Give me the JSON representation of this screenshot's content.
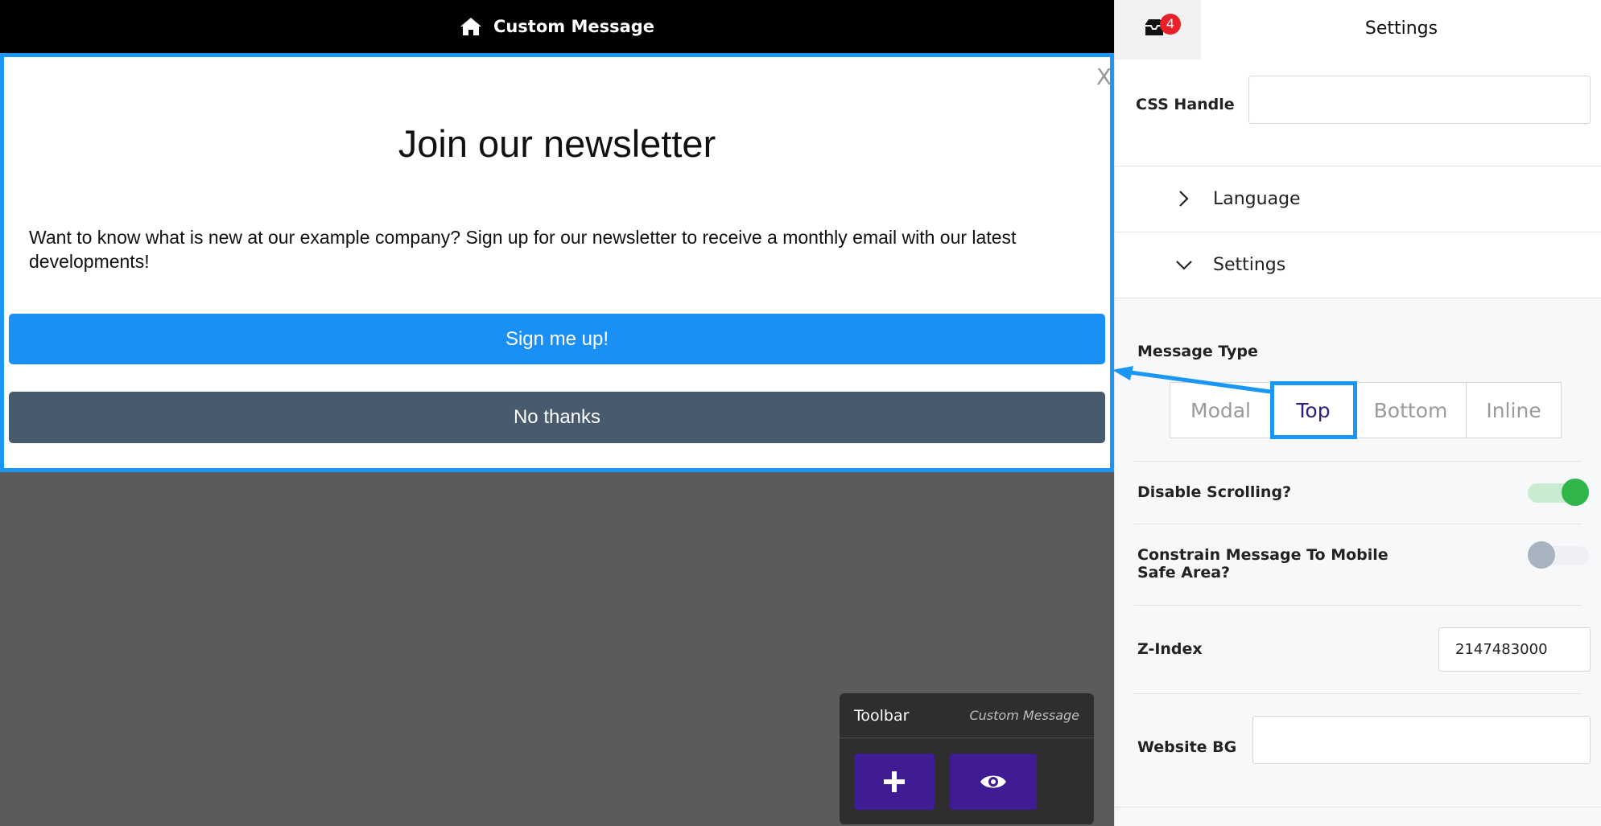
{
  "preview": {
    "topbar": {
      "title": "Custom Message",
      "icon": "home-icon"
    },
    "message": {
      "close_label": "X",
      "headline": "Join our newsletter",
      "body": "Want to know what is new at our example company? Sign up for our newsletter to receive a monthly email with our latest developments!",
      "primary_button": "Sign me up!",
      "secondary_button": "No thanks",
      "border_color": "#1a96f5",
      "primary_color": "#1a8ff5",
      "secondary_color": "#475a6e"
    },
    "toolbar": {
      "title": "Toolbar",
      "subtitle": "Custom Message",
      "buttons": [
        {
          "icon": "plus-icon"
        },
        {
          "icon": "eye-icon"
        }
      ],
      "button_color": "#3f1b94"
    }
  },
  "panel": {
    "notifications": {
      "count": "4",
      "icon": "inbox-icon"
    },
    "title": "Settings",
    "css_handle": {
      "label": "CSS Handle",
      "value": ""
    },
    "sections": [
      {
        "label": "Language",
        "expanded": false
      },
      {
        "label": "Settings",
        "expanded": true
      }
    ],
    "message_type": {
      "label": "Message Type",
      "options": [
        "Modal",
        "Top",
        "Bottom",
        "Inline"
      ],
      "selected": "Top"
    },
    "disable_scrolling": {
      "label": "Disable Scrolling?",
      "on": true
    },
    "constrain_mobile": {
      "label": "Constrain Message To Mobile Safe Area?",
      "on": false
    },
    "z_index": {
      "label": "Z-Index",
      "value": "2147483000"
    },
    "website_bg": {
      "label": "Website BG",
      "value": ""
    }
  }
}
